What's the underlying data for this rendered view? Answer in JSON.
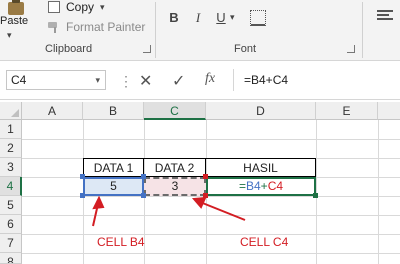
{
  "ribbon": {
    "paste_label": "Paste",
    "copy_label": "Copy",
    "format_painter_label": "Format Painter",
    "clipboard_group_label": "Clipboard",
    "font_group_label": "Font",
    "bold_label": "B",
    "italic_label": "I",
    "underline_label": "U"
  },
  "formula_bar": {
    "name_box": "C4",
    "cancel_symbol": "✕",
    "enter_symbol": "✓",
    "fx_label": "fx",
    "formula": "=B4+C4"
  },
  "sheet": {
    "columns": [
      "A",
      "B",
      "C",
      "D",
      "E"
    ],
    "rows": [
      "1",
      "2",
      "3",
      "4",
      "5",
      "6",
      "7",
      "8"
    ],
    "headers": {
      "data1": "DATA 1",
      "data2": "DATA 2",
      "hasil": "HASIL"
    },
    "values": {
      "b4": "5",
      "c4": "3",
      "d4_eq": "=",
      "d4_b4": "B4",
      "d4_plus": "+",
      "d4_c4": "C4"
    }
  },
  "annotations": {
    "cell_b4": "CELL B4",
    "cell_c4": "CELL C4"
  },
  "colors": {
    "b4_highlight": "#4472c4",
    "c4_highlight": "#d31d23",
    "selection": "#1e7145",
    "annotation": "#d31d23"
  }
}
